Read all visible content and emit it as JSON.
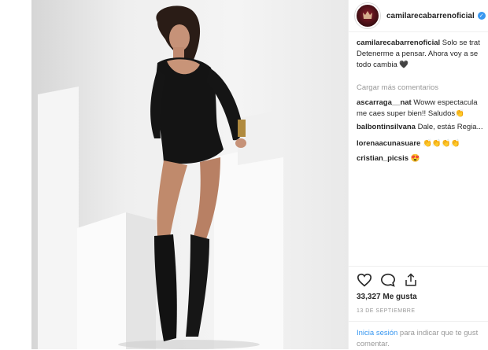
{
  "post": {
    "username": "camilarecabarrenoficial",
    "caption_text": "Solo se trat",
    "caption_line2": "Detenerme a pensar. Ahora voy a se",
    "caption_line3": "todo cambia",
    "caption_emoji": "🖤"
  },
  "comments_section": {
    "load_more": "Cargar más comentarios",
    "comments": [
      {
        "user": "ascarraga__nat",
        "text": "Woww espectacula",
        "text2": "me caes super bien!! Saludos👏"
      },
      {
        "user": "balbontinsilvana",
        "text": "Dale, estás Regia..."
      },
      {
        "user": "lorenaacunasuare",
        "text": "👏👏👏👏"
      },
      {
        "user": "cristian_picsis",
        "text": "😍"
      }
    ]
  },
  "actions": {
    "like_icon": "heart-icon",
    "comment_icon": "comment-icon",
    "share_icon": "share-icon",
    "likes": "33,327 Me gusta",
    "date": "13 DE SEPTIEMBRE"
  },
  "login": {
    "link": "Inicia sesión",
    "text": "para indicar que te gust",
    "text2": "comentar."
  },
  "colors": {
    "link": "#3897f0",
    "muted": "#999999",
    "text": "#262626",
    "border": "#efefef"
  }
}
